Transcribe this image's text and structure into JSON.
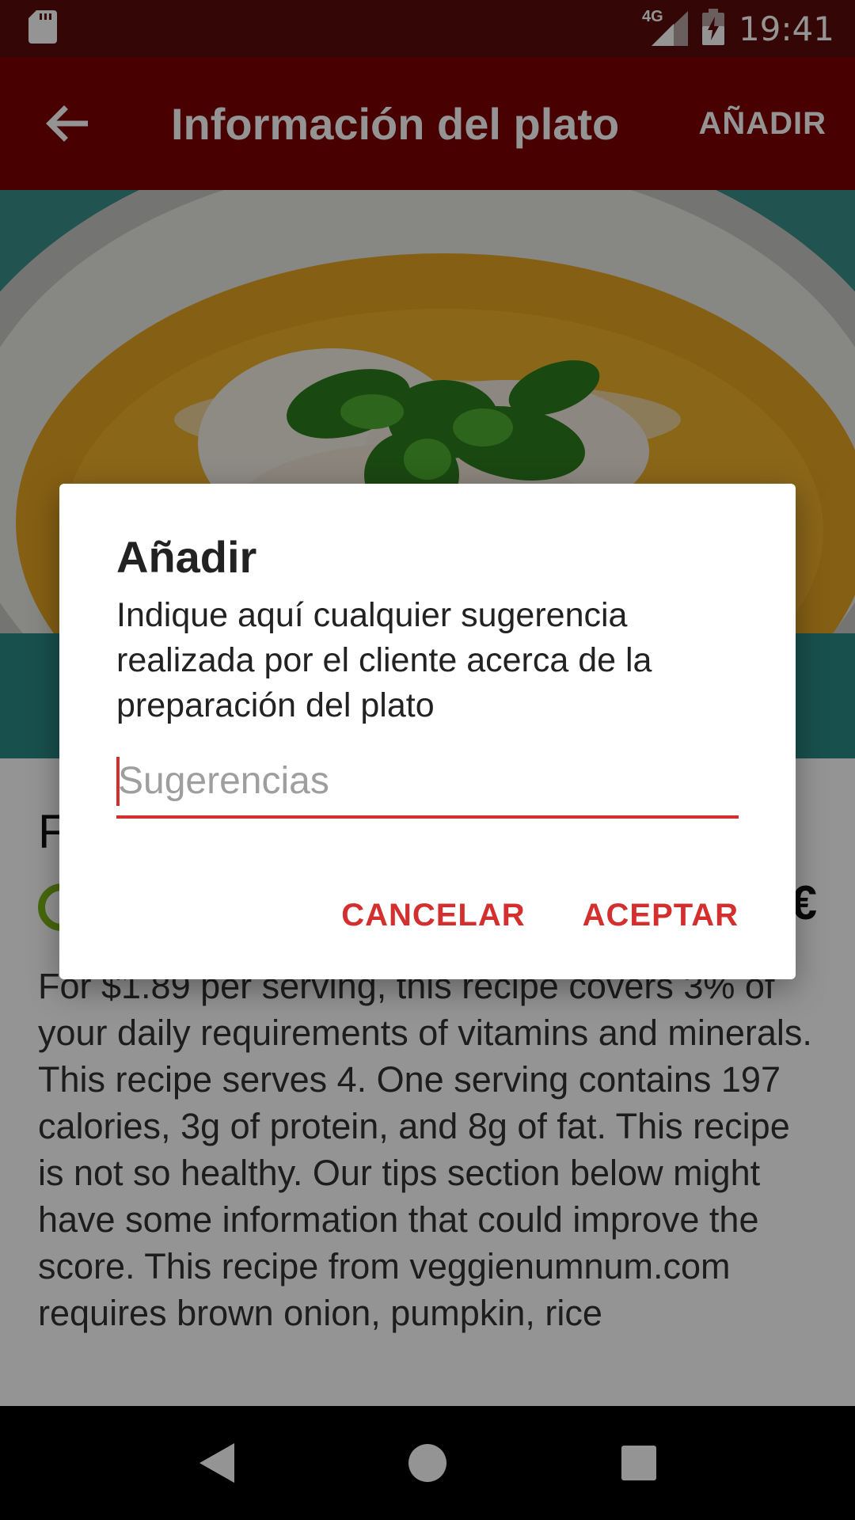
{
  "status_bar": {
    "time": "19:41",
    "network": "4G",
    "icons": [
      "sd-card-icon",
      "signal-icon",
      "battery-charging-icon"
    ]
  },
  "app_bar": {
    "title": "Información del plato",
    "action_label": "AÑADIR",
    "back_icon": "arrow-left-icon"
  },
  "dish": {
    "name": "F",
    "price_symbol": "€",
    "summary": "For $1.89 per serving, this recipe covers 3% of your daily requirements of vitamins and minerals. This recipe serves 4. One serving contains 197 calories, 3g of protein, and 8g of fat. This recipe is not so healthy. Our tips section below might have some information that could improve the score. This recipe from veggienumnum.com requires brown onion, pumpkin, rice"
  },
  "dialog": {
    "title": "Añadir",
    "message": "Indique aquí cualquier sugerencia realizada por el cliente acerca de la preparación del plato",
    "input_value": "",
    "input_placeholder": "Sugerencias",
    "cancel_label": "CANCELAR",
    "accept_label": "ACEPTAR"
  },
  "nav_bar": {
    "icons": [
      "back-triangle-icon",
      "home-circle-icon",
      "recents-square-icon"
    ]
  },
  "colors": {
    "status_bar": "#5a0b0b",
    "app_bar": "#7f0000",
    "accent": "#d32f2f"
  }
}
